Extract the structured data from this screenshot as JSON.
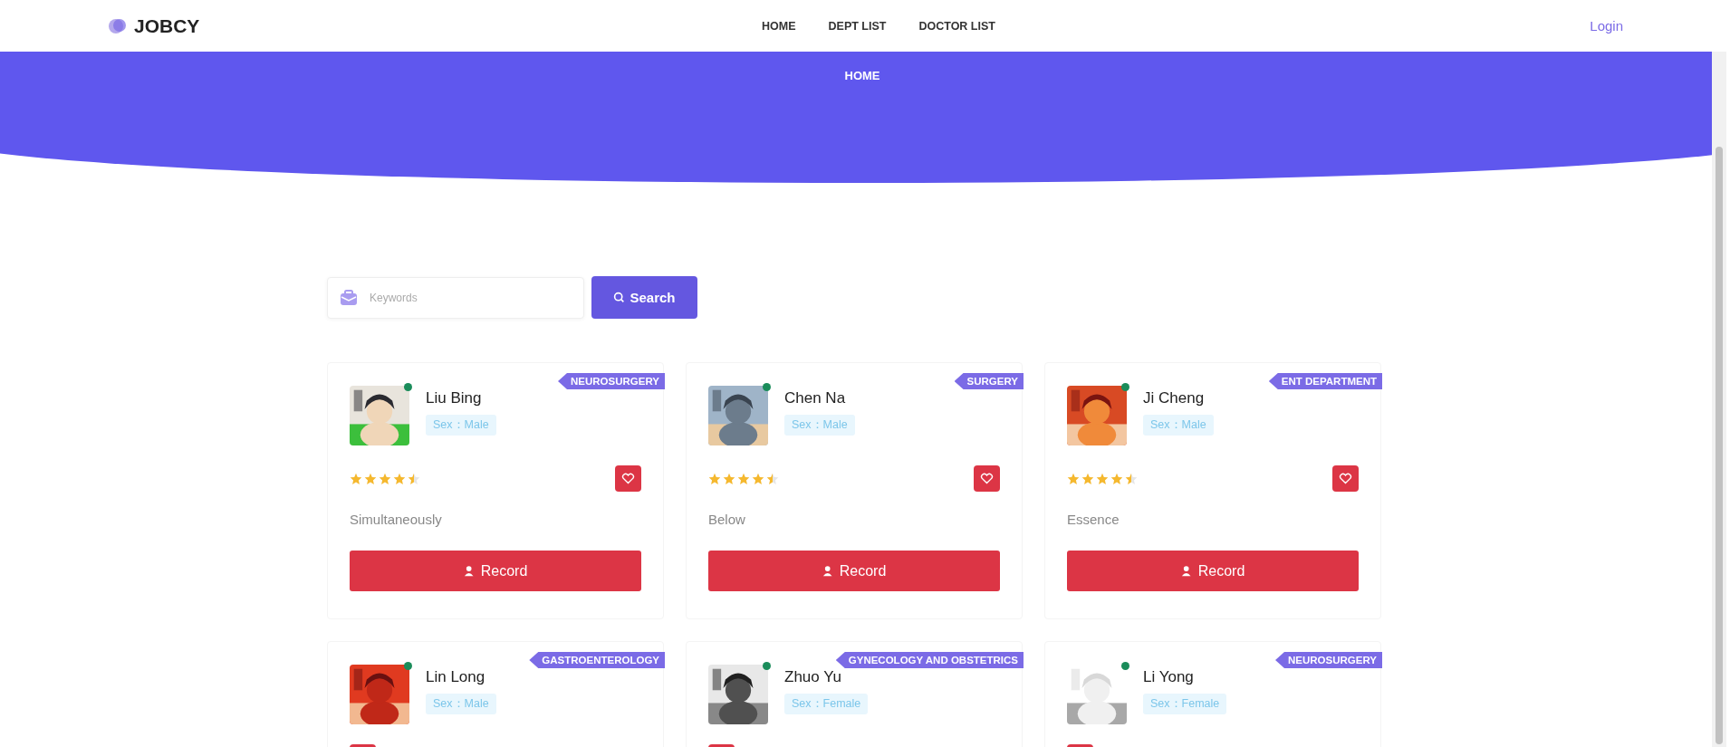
{
  "brand": "JOBCY",
  "nav": [
    {
      "label": "HOME"
    },
    {
      "label": "DEPT LIST"
    },
    {
      "label": "DOCTOR LIST"
    }
  ],
  "login": "Login",
  "banner": {
    "title": "HOME"
  },
  "search": {
    "placeholder": "Keywords",
    "button": "Search"
  },
  "doctors": [
    {
      "name": "Liu Bing",
      "sex": "Sex：Male",
      "department": "NEUROSURGERY",
      "online": true,
      "stars": 4.5,
      "note": "Simultaneously",
      "action": "Record"
    },
    {
      "name": "Chen Na",
      "sex": "Sex：Male",
      "department": "SURGERY",
      "online": true,
      "stars": 4.5,
      "note": "Below",
      "action": "Record"
    },
    {
      "name": "Ji Cheng",
      "sex": "Sex：Male",
      "department": "ENT DEPARTMENT",
      "online": true,
      "stars": 4.5,
      "note": "Essence",
      "action": "Record"
    },
    {
      "name": "Lin Long",
      "sex": "Sex：Male",
      "department": "GASTROENTEROLOGY",
      "online": true
    },
    {
      "name": "Zhuo Yu",
      "sex": "Sex：Female",
      "department": "GYNECOLOGY AND OBSTETRICS",
      "online": true
    },
    {
      "name": "Li Yong",
      "sex": "Sex：Female",
      "department": "NEUROSURGERY",
      "online": true
    }
  ]
}
